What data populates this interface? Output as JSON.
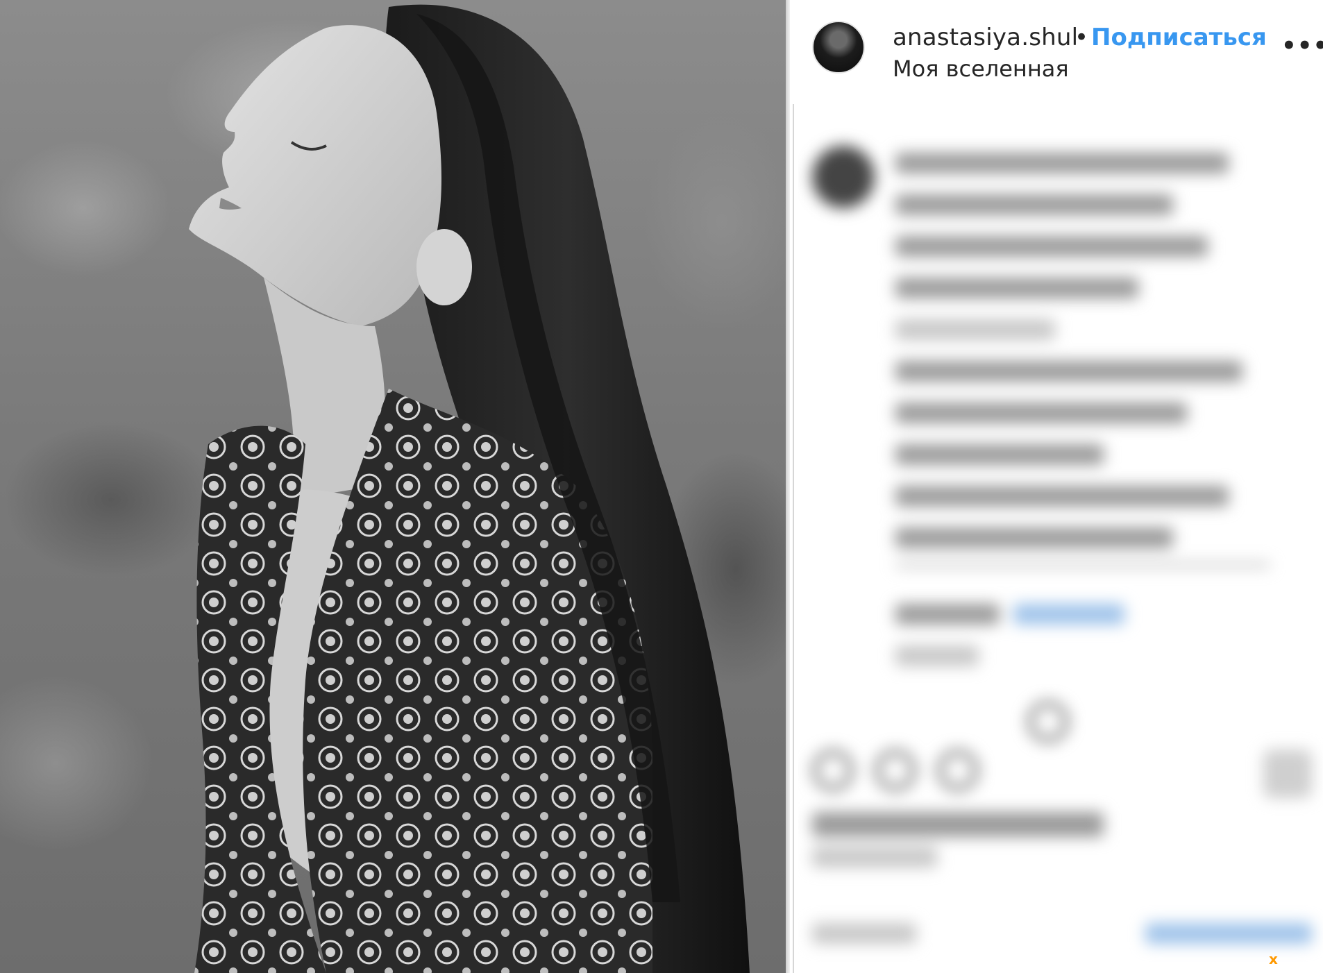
{
  "post": {
    "username": "anastasiya.shul",
    "separator": "•",
    "follow_label": "Подписаться",
    "location": "Моя вселенная",
    "more_label": "•••",
    "close_label": "x"
  },
  "colors": {
    "follow": "#3897f0",
    "text": "#262626",
    "close": "#ff9900"
  },
  "icons": [
    "avatar",
    "more-options-icon",
    "close-icon"
  ]
}
